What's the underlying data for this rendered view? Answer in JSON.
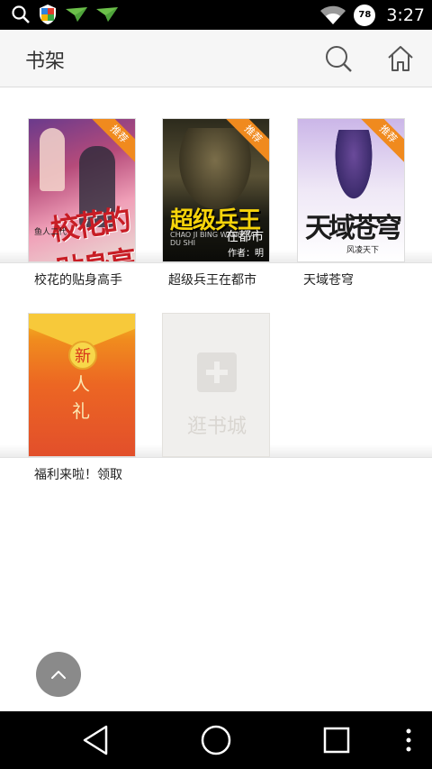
{
  "status_bar": {
    "time": "3:27",
    "battery_level": "78"
  },
  "header": {
    "title": "书架",
    "search_icon": "search-icon",
    "home_icon": "home-icon"
  },
  "books": [
    {
      "title": "校花的贴身高手",
      "tag": "推荐",
      "cover_text": "校花的贴身高手",
      "cover_small": "鱼人二代"
    },
    {
      "title": "超级兵王在都市",
      "tag": "推荐",
      "cover_text": "超级兵王",
      "cover_sub": "在都市",
      "cover_en": "CHAO JI BING WANG ZAI DU SHI",
      "cover_author": "作者：明日复明日"
    },
    {
      "title": "天域苍穹",
      "tag": "推荐",
      "cover_text": "天域苍穹",
      "cover_sub": "风凌天下"
    },
    {
      "title": "福利来啦！领取",
      "cover_seal": "新",
      "cover_line1": "人",
      "cover_line2": "礼"
    }
  ],
  "add_book": {
    "label": "逛书城"
  },
  "nav": {
    "back_icon": "back-triangle-icon",
    "home_icon": "home-circle-icon",
    "recent_icon": "recent-apps-icon",
    "more_icon": "more-vertical-icon"
  },
  "colors": {
    "header_bg": "#f6f6f6",
    "tag_orange": "#f08a1e",
    "status_bar_bg": "#000000",
    "nav_bar_bg": "#000000"
  }
}
